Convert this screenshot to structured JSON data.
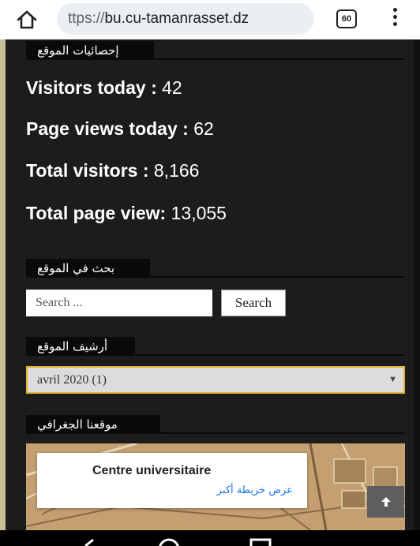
{
  "browser": {
    "url_prefix": "ttps://",
    "url_host": "bu.cu-tamanrasset.dz",
    "tab_count": "60"
  },
  "stats": {
    "title": "إحصائيات الموقع",
    "visitors_today_label": "Visitors today :",
    "visitors_today_value": "42",
    "page_views_today_label": "Page views today :",
    "page_views_today_value": "62",
    "total_visitors_label": "Total visitors :",
    "total_visitors_value": "8,166",
    "total_page_view_label": "Total page view:",
    "total_page_view_value": "13,055"
  },
  "search": {
    "title": "بحث في الموقع",
    "placeholder": "Search ...",
    "button_label": "Search"
  },
  "archive": {
    "title": "أرشيف الموقع",
    "selected": "avril 2020  (1)"
  },
  "map": {
    "title": "موقعنا الجغرافي",
    "place_name": "Centre universitaire",
    "larger_map_link": "عرض خريطة أكبر"
  },
  "colors": {
    "accent_border": "#e0b534",
    "page_background": "#1c1c1c",
    "link": "#1a73e8"
  }
}
